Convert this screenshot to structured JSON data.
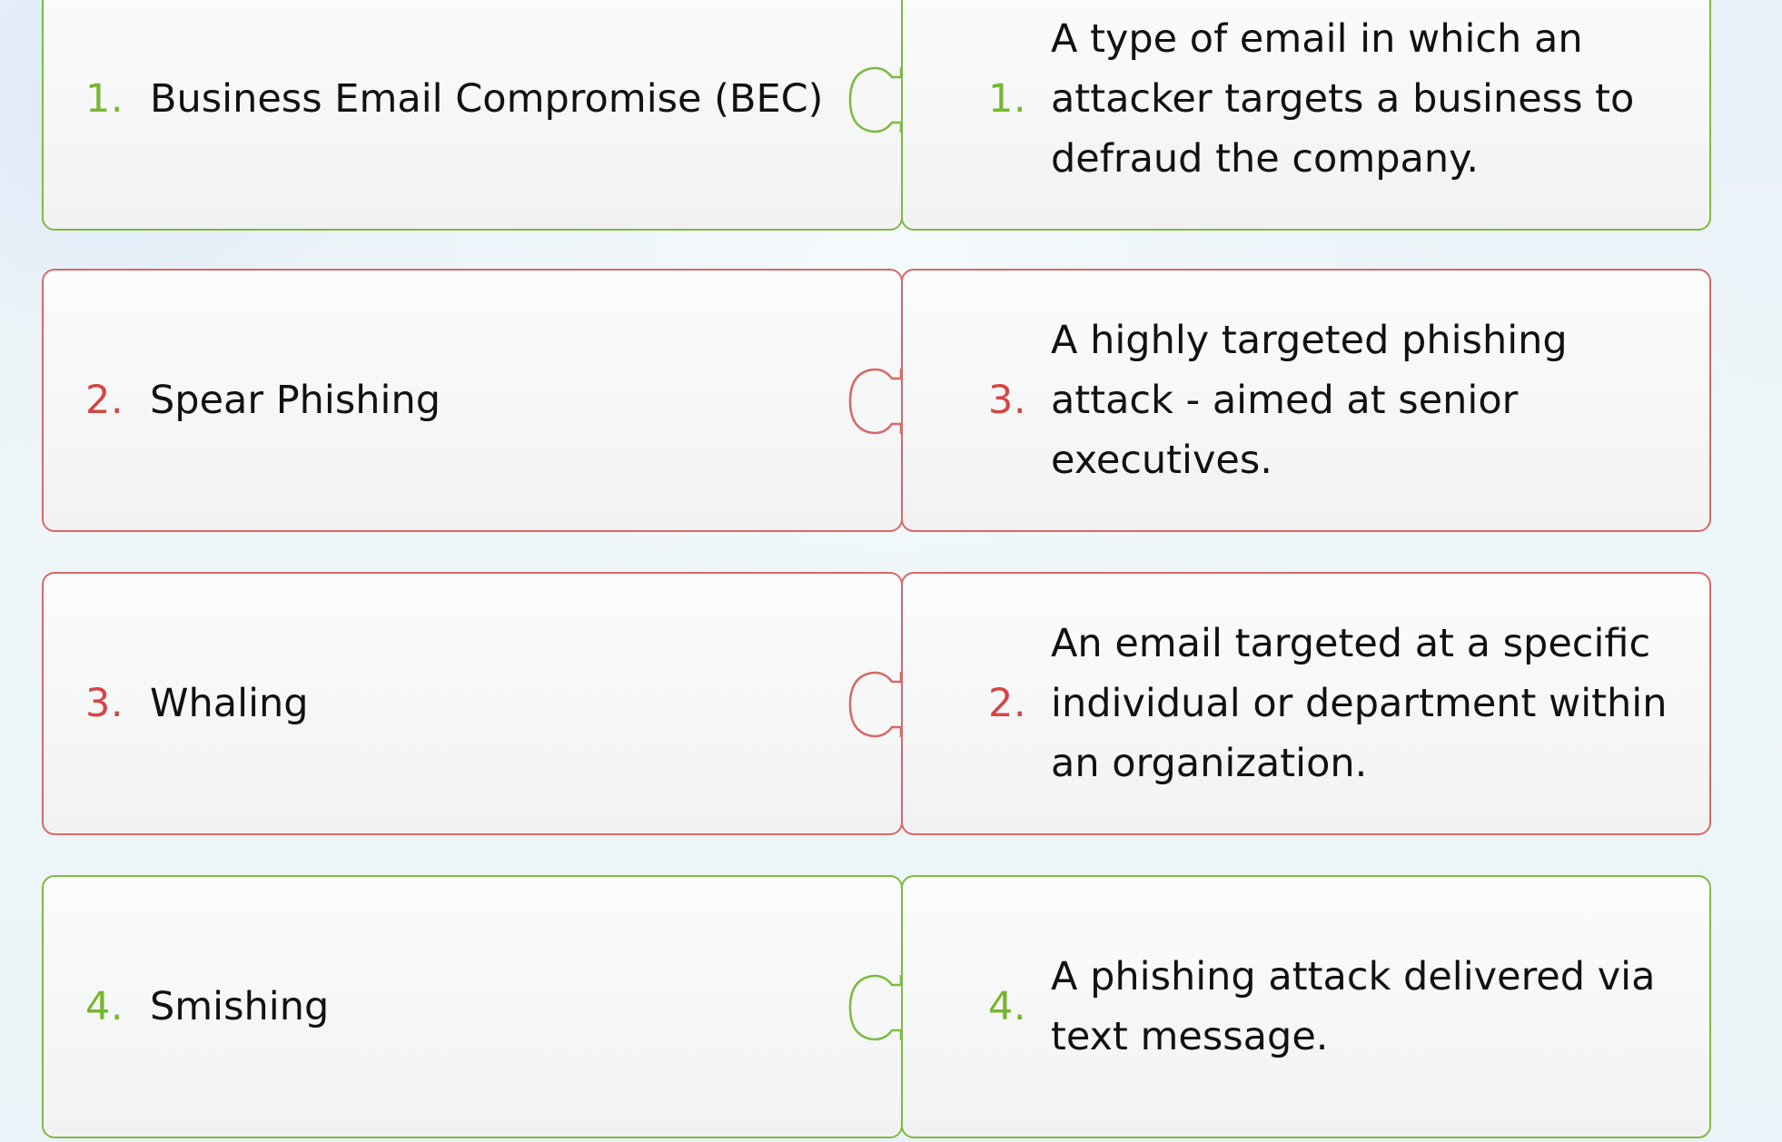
{
  "rows": [
    {
      "status": "correct",
      "left_num": "1.",
      "term": "Business Email Compromise (BEC)",
      "right_num": "1.",
      "description": "A type of email in which an attacker targets a business to defraud the company."
    },
    {
      "status": "incorrect",
      "left_num": "2.",
      "term": "Spear Phishing",
      "right_num": "3.",
      "description": " A highly targeted phishing attack - aimed at senior executives."
    },
    {
      "status": "incorrect",
      "left_num": "3.",
      "term": "Whaling",
      "right_num": "2.",
      "description": "An email targeted at a specific individual or department within an organization."
    },
    {
      "status": "correct",
      "left_num": "4.",
      "term": "Smishing",
      "right_num": "4.",
      "description": "A phishing attack delivered via text message."
    }
  ],
  "colors": {
    "correct": "#7dbb42",
    "incorrect": "#d96868",
    "correct_number": "#74b72e",
    "incorrect_number": "#d64545"
  }
}
